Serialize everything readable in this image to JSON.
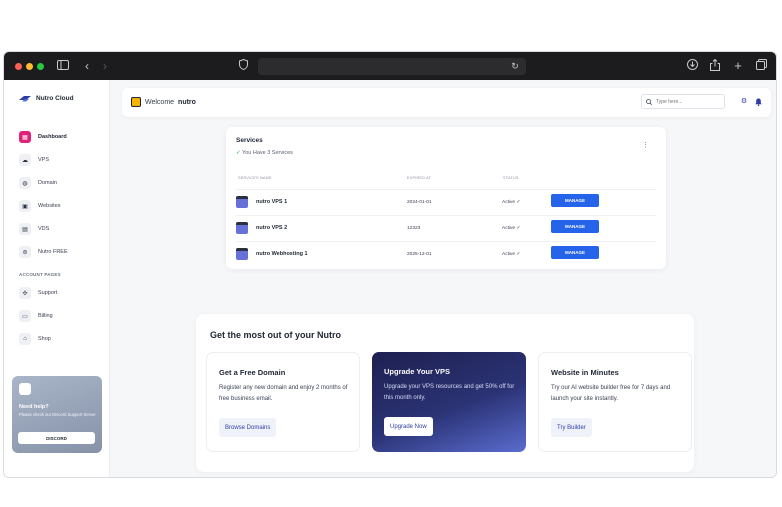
{
  "sidebar": {
    "brand": "Nutro Cloud",
    "items": [
      {
        "label": "Dashboard",
        "icon": "dashboard-icon",
        "active": true
      },
      {
        "label": "VPS",
        "icon": "cloud-icon"
      },
      {
        "label": "Domain",
        "icon": "globe-icon"
      },
      {
        "label": "Websites",
        "icon": "window-icon"
      },
      {
        "label": "VDS",
        "icon": "server-icon"
      },
      {
        "label": "Nutro FREE",
        "icon": "free-icon"
      }
    ],
    "section_label": "ACCOUNT PAGES",
    "account_items": [
      {
        "label": "Support",
        "icon": "support-icon"
      },
      {
        "label": "Billing",
        "icon": "billing-icon"
      },
      {
        "label": "Shop",
        "icon": "shop-icon"
      }
    ],
    "help": {
      "title": "Need help?",
      "text": "Please check our Discord Support Server",
      "button": "DISCORD"
    }
  },
  "header": {
    "welcome": "Welcome",
    "user": "nutro",
    "search_placeholder": "Type here..."
  },
  "services": {
    "title": "Services",
    "subtitle": "You Have 3 Services",
    "columns": [
      "SERVICES NAME",
      "EXPIRED AT",
      "STATUS"
    ],
    "rows": [
      {
        "name": "nutro VPS 1",
        "expired": "2024-01-01",
        "status": "Active ✓",
        "action": "MANAGE"
      },
      {
        "name": "nutro VPS 2",
        "expired": "12323",
        "status": "Active ✓",
        "action": "MANAGE"
      },
      {
        "name": "nutro Webhosting 1",
        "expired": "2025-12-01",
        "status": "Active ✓",
        "action": "MANAGE"
      }
    ]
  },
  "promo": {
    "title": "Get the most out of your Nutro",
    "cards": [
      {
        "title": "Get a Free Domain",
        "text": "Register any new domain and enjoy 2 months of free business email.",
        "button": "Browse Domains"
      },
      {
        "title": "Upgrade Your VPS",
        "text": "Upgrade your VPS resources and get 50% off for this month only.",
        "button": "Upgrade Now"
      },
      {
        "title": "Website in Minutes",
        "text": "Try our AI website builder free for 7 days and launch your site instantly.",
        "button": "Try Builder"
      }
    ]
  },
  "colors": {
    "accent": "#2563eb",
    "active_nav": "#e0237a",
    "titlebar": "#1c1c1e"
  }
}
